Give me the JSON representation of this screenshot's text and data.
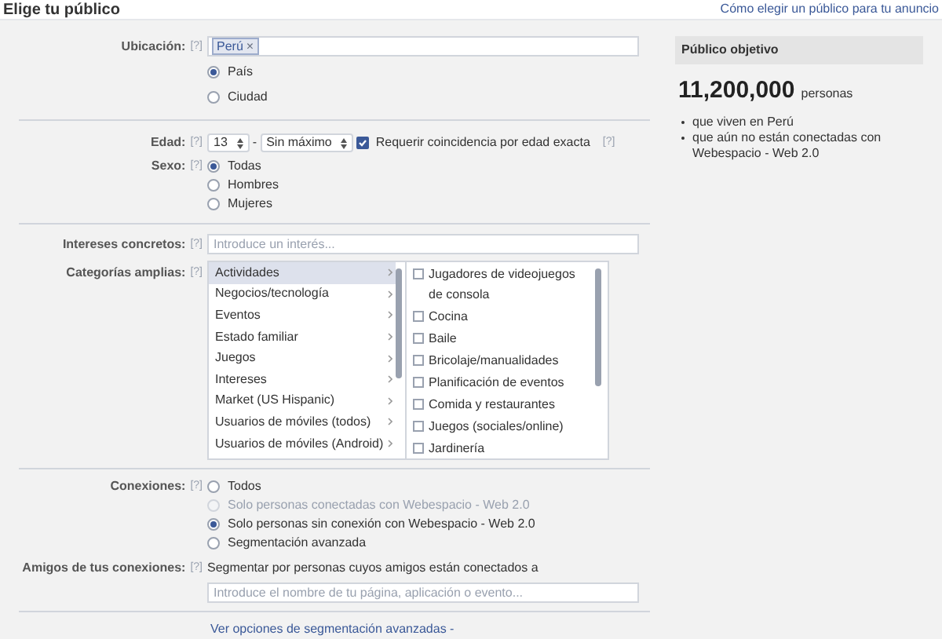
{
  "header": {
    "title": "Elige tu público",
    "help_link": "Cómo elegir un público para tu anuncio"
  },
  "location": {
    "label": "Ubicación:",
    "help": "[?]",
    "token": "Perú",
    "token_remove": "×",
    "options": [
      {
        "label": "País",
        "selected": true
      },
      {
        "label": "Ciudad",
        "selected": false
      }
    ]
  },
  "age": {
    "label": "Edad:",
    "help": "[?]",
    "min": "13",
    "separator": "-",
    "max": "Sin máximo",
    "exact_match": {
      "label": "Requerir coincidencia por edad exacta",
      "checked": true,
      "help": "[?]"
    }
  },
  "sex": {
    "label": "Sexo:",
    "help": "[?]",
    "options": [
      {
        "label": "Todas",
        "selected": true
      },
      {
        "label": "Hombres",
        "selected": false
      },
      {
        "label": "Mujeres",
        "selected": false
      }
    ]
  },
  "interests": {
    "label": "Intereses concretos:",
    "help": "[?]",
    "placeholder": "Introduce un interés..."
  },
  "categories": {
    "label": "Categorías amplias:",
    "help": "[?]",
    "groups": [
      {
        "label": "Actividades",
        "selected": true
      },
      {
        "label": "Negocios/tecnología",
        "selected": false
      },
      {
        "label": "Eventos",
        "selected": false
      },
      {
        "label": "Estado familiar",
        "selected": false
      },
      {
        "label": "Juegos",
        "selected": false
      },
      {
        "label": "Intereses",
        "selected": false
      },
      {
        "label": "Market (US Hispanic)",
        "selected": false
      },
      {
        "label": "Usuarios de móviles (todos)",
        "selected": false
      },
      {
        "label": "Usuarios de móviles (Android)",
        "selected": false
      }
    ],
    "items": [
      {
        "label": "Jugadores de videojuegos de consola",
        "checked": false
      },
      {
        "label": "Cocina",
        "checked": false
      },
      {
        "label": "Baile",
        "checked": false
      },
      {
        "label": "Bricolaje/manualidades",
        "checked": false
      },
      {
        "label": "Planificación de eventos",
        "checked": false
      },
      {
        "label": "Comida y restaurantes",
        "checked": false
      },
      {
        "label": "Juegos (sociales/online)",
        "checked": false
      },
      {
        "label": "Jardinería",
        "checked": false
      }
    ]
  },
  "connections": {
    "label": "Conexiones:",
    "help": "[?]",
    "options": [
      {
        "label": "Todos",
        "selected": false,
        "disabled": false
      },
      {
        "label": "Solo personas conectadas con Webespacio - Web 2.0",
        "selected": false,
        "disabled": true
      },
      {
        "label": "Solo personas sin conexión con Webespacio - Web 2.0",
        "selected": true,
        "disabled": false
      },
      {
        "label": "Segmentación avanzada",
        "selected": false,
        "disabled": false
      }
    ]
  },
  "friends": {
    "label": "Amigos de tus conexiones:",
    "help": "[?]",
    "description": "Segmentar por personas cuyos amigos están conectados a",
    "placeholder": "Introduce el nombre de tu página, aplicación o evento..."
  },
  "advanced_link": "Ver opciones de segmentación avanzadas -",
  "audience": {
    "title": "Público objetivo",
    "count": "11,200,000",
    "unit": "personas",
    "bullets": [
      "que viven en Perú",
      "que aún no están conectadas con Webespacio - Web 2.0"
    ]
  }
}
